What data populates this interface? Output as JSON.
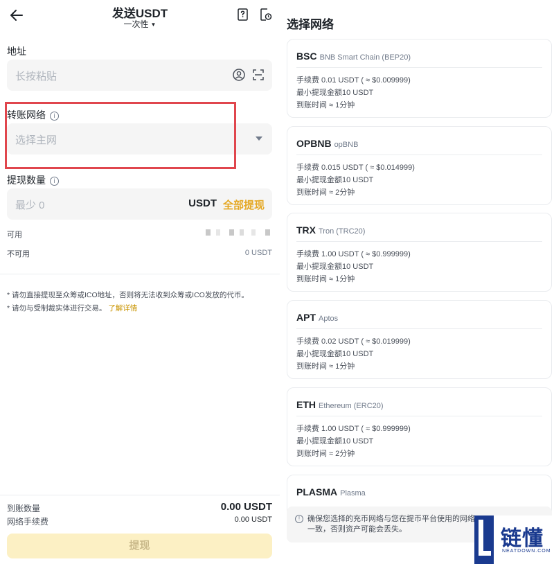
{
  "header": {
    "title": "发送USDT",
    "mode": "一次性"
  },
  "form": {
    "address_label": "地址",
    "address_placeholder": "长按粘贴",
    "network_label": "转账网络",
    "network_placeholder": "选择主网",
    "amount_label": "提现数量",
    "amount_placeholder": "最少 0",
    "amount_unit": "USDT",
    "withdraw_all": "全部提现",
    "available_label": "可用",
    "unavailable_label": "不可用",
    "unavailable_value": "0 USDT",
    "note_1": "* 请勿直接提现至众筹或ICO地址，否则将无法收到众筹或ICO发放的代币。",
    "note_2": "* 请勿与受制裁实体进行交易。",
    "note_link": "了解详情"
  },
  "footer": {
    "receive_label": "到账数量",
    "receive_value": "0.00 USDT",
    "fee_label": "网络手续费",
    "fee_value": "0.00 USDT",
    "submit_label": "提现"
  },
  "network_panel": {
    "title": "选择网络",
    "networks": [
      {
        "code": "BSC",
        "name": "BNB Smart Chain (BEP20)",
        "fee": "手续费 0.01 USDT ( ≈ $0.009999)",
        "min": "最小提现金额10 USDT",
        "time": "到账时间 ≈ 1分钟"
      },
      {
        "code": "OPBNB",
        "name": "opBNB",
        "fee": "手续费 0.015 USDT ( ≈ $0.014999)",
        "min": "最小提现金额10 USDT",
        "time": "到账时间 ≈ 2分钟"
      },
      {
        "code": "TRX",
        "name": "Tron (TRC20)",
        "fee": "手续费 1.00 USDT ( ≈ $0.999999)",
        "min": "最小提现金额10 USDT",
        "time": "到账时间 ≈ 1分钟"
      },
      {
        "code": "APT",
        "name": "Aptos",
        "fee": "手续费 0.02 USDT ( ≈ $0.019999)",
        "min": "最小提现金额10 USDT",
        "time": "到账时间 ≈ 1分钟"
      },
      {
        "code": "ETH",
        "name": "Ethereum (ERC20)",
        "fee": "手续费 1.00 USDT ( ≈ $0.999999)",
        "min": "最小提现金额10 USDT",
        "time": "到账时间 ≈ 2分钟"
      },
      {
        "code": "PLASMA",
        "name": "Plasma",
        "fee": "",
        "min": "",
        "time": ""
      }
    ],
    "warning": "确保您选择的充币网络与您在提币平台使用的网络一致，否则资产可能会丢失。"
  },
  "watermark": {
    "cn": "链懂",
    "en": "NEATDOWN.COM"
  },
  "colors": {
    "accent": "#e5a823",
    "highlight_box": "#e0464d",
    "logo": "#1a3a8f"
  }
}
